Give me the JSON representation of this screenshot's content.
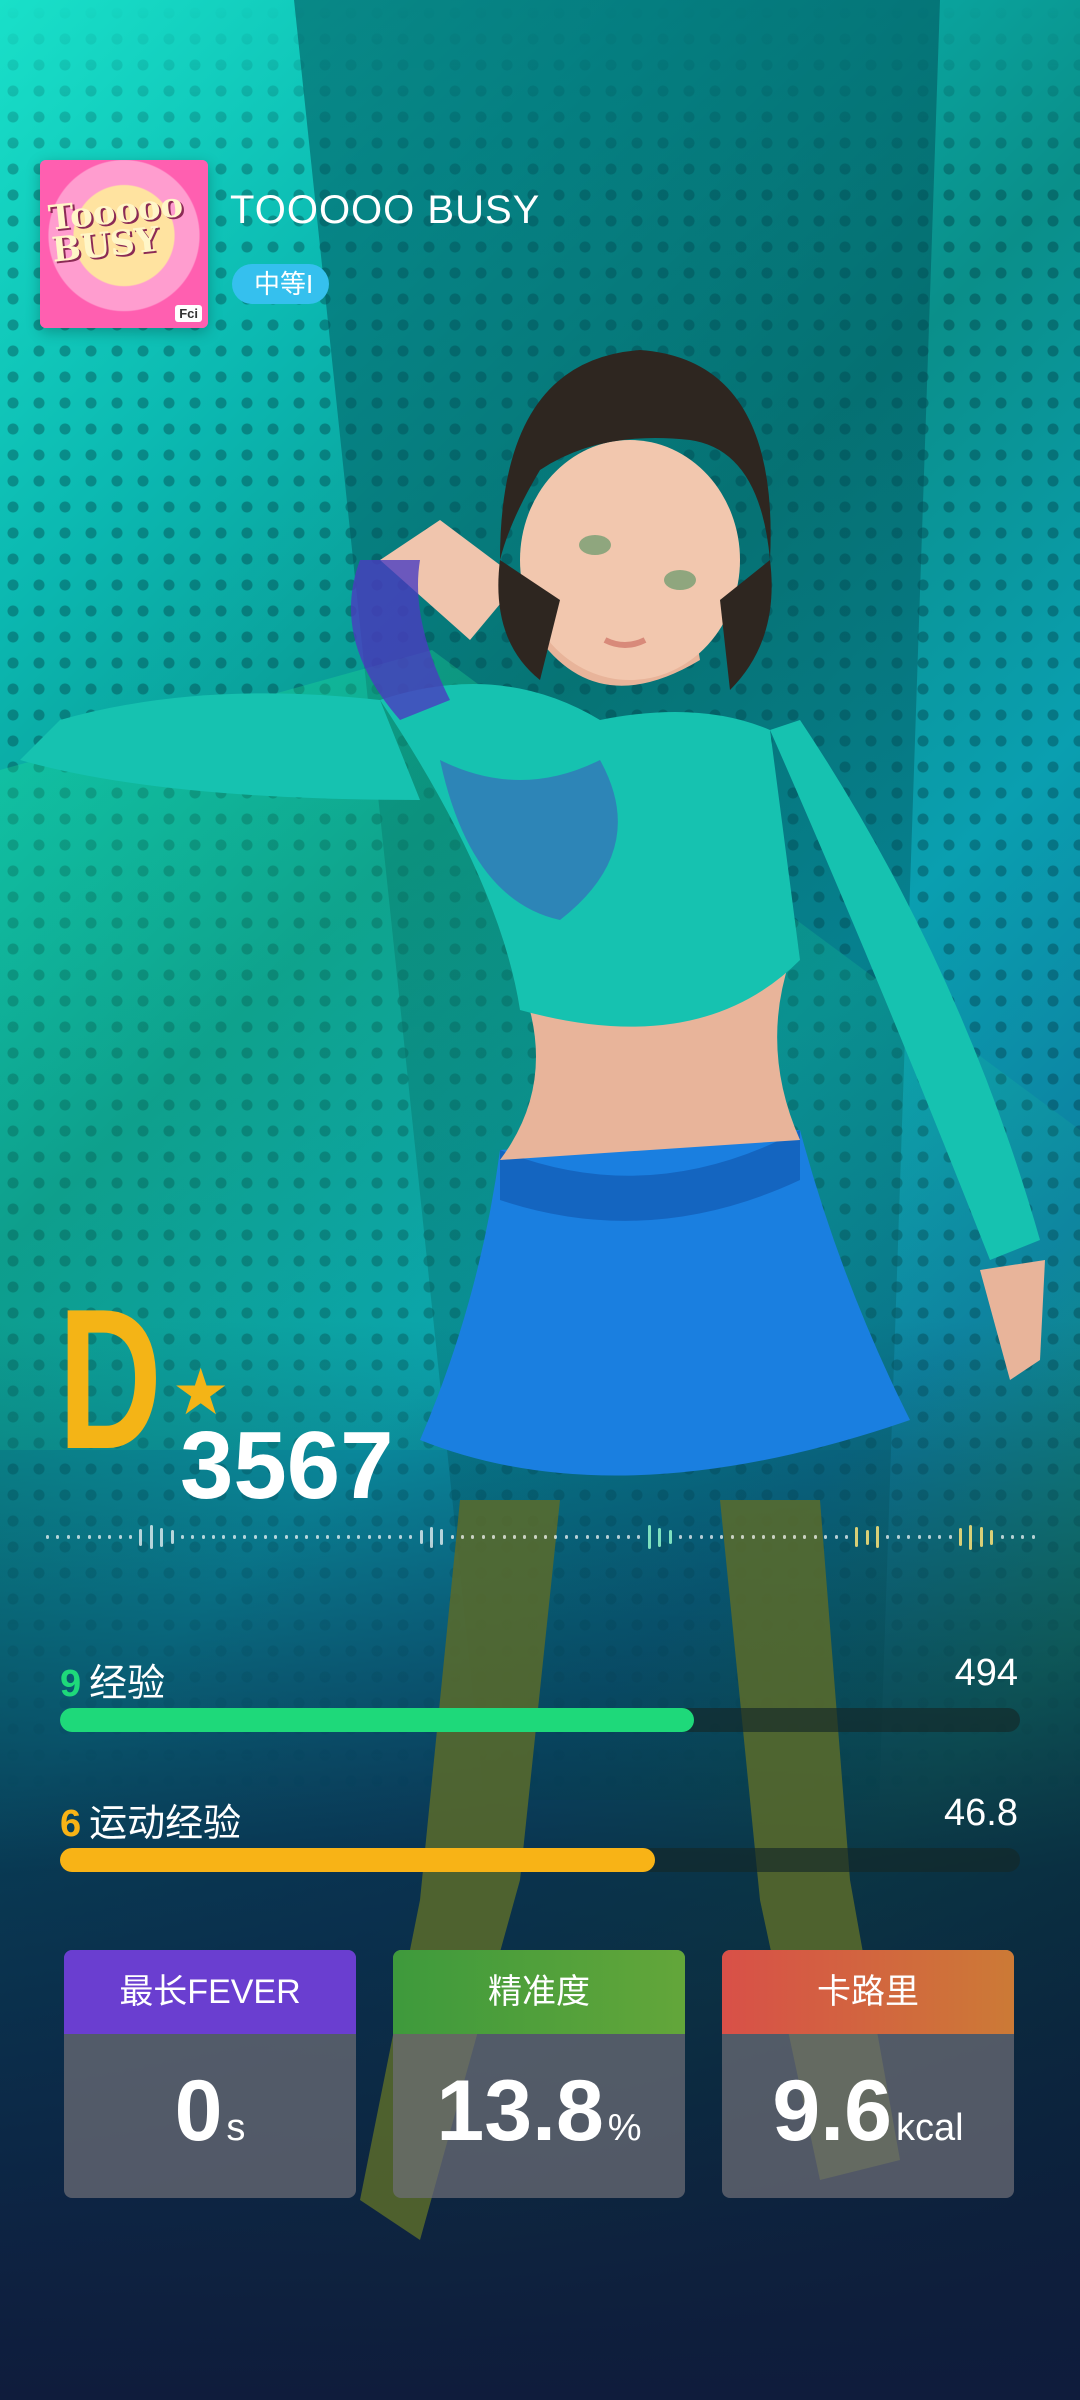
{
  "song": {
    "cover_text": "Tooooo BUSY",
    "cover_tag": "Fci",
    "title": "TOOOOO BUSY",
    "difficulty": "中等I"
  },
  "result": {
    "grade": "D",
    "score": "3567"
  },
  "progress": [
    {
      "level": "9",
      "label": "经验",
      "value": "494",
      "fill_fraction": 0.66,
      "color": "#1ed97a"
    },
    {
      "level": "6",
      "label": "运动经验",
      "value": "46.8",
      "fill_fraction": 0.62,
      "color": "#f8b316"
    }
  ],
  "stats": [
    {
      "label": "最长FEVER",
      "value": "0",
      "unit": "s",
      "head_color": "#6a3ed0"
    },
    {
      "label": "精准度",
      "value": "13.8",
      "unit": "%",
      "head_color": "#4a9a3a"
    },
    {
      "label": "卡路里",
      "value": "9.6",
      "unit": "kcal",
      "head_color": "#d65a46"
    }
  ],
  "colors": {
    "grade": "#f4b416",
    "difficulty_pill": "#35c0ee",
    "exp_level": "#1ed97a",
    "sport_level": "#f8b316"
  }
}
